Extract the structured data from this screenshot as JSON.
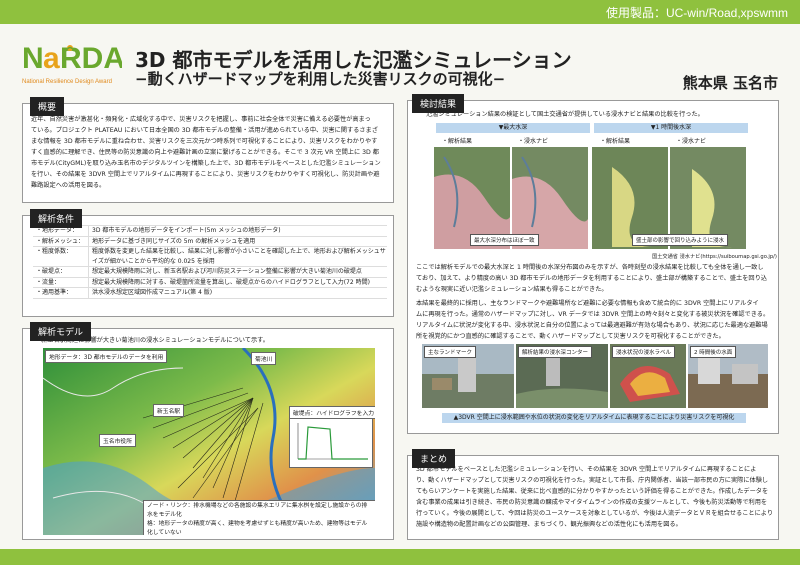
{
  "header": {
    "software": "使用製品：UC-win/Road,xpswmm",
    "logo_text": "NaRDA",
    "logo_sub": "National Resilience Design Award",
    "title": "3D 都市モデルを活用した氾濫シミュレーション",
    "subtitle": "−動くハザードマップを利用した災害リスクの可視化−",
    "city": "熊本県 玉名市"
  },
  "overview": {
    "heading": "概要",
    "lines": [
      "近年、自然災害が激甚化・頻発化・広域化する中で、災害リスクを把握し、事前に社会全体で災害に備える必要性が高まっ",
      "ている。プロジェクト PLATEAU において日本全国の 3D 都市モデルの整備・活用が進められている中、災害に関するさまざ",
      "まな情報を 3D 都市モデルに重ね合わせ、災害リスクを三次元かつ時系列で可視化することにより、災害リスクをわかりやす",
      "すく直感的に理解でき、住民等の防災意識の向上や避難計画の立案に繋げることができる。そこで 3 次元 VR 空間上に 3D 都",
      "市モデル(CityGML)を取り込み玉名市のデジタルツインを構築した上で、3D 都市モデルをベースとした氾濫シミュレーション",
      "を行い、その結果を 3DVR 空間上でリアルタイムに再現することにより、災害リスクをわかりやすく可視化し、防災計画や避",
      "難路設定への活用を図る。"
    ]
  },
  "conditions": {
    "heading": "解析条件",
    "rows": [
      {
        "k": "・地形データ：",
        "v": "3D 都市モデルの地形データをインポート(5m メッシュの地形データ)"
      },
      {
        "k": "・解析メッシュ：",
        "v": "地形データに基づき同じサイズの 5m の解析メッシュを適用"
      },
      {
        "k": "・粗度係数：",
        "v": "粗度係数を変更した結果を比較し、結果に対し影響が小さいことを確認した上で、地形および解析メッシュサイズが細かいことから平均的な 0.025 を採用"
      },
      {
        "k": "・破堤点：",
        "v": "想定最大規模降雨に対し、新玉名駅および河川防災ステーション整備に影響が大きい菊池川の破堤点"
      },
      {
        "k": "・流量：",
        "v": "想定最大規模降雨に対する、破堤箇所流量を算出し、破堤点からのハイドログラフとして入力(72 時間)"
      },
      {
        "k": "・適用基準：",
        "v": "洪水浸水想定区域図作成マニュアル(第 4 版)"
      }
    ]
  },
  "model": {
    "heading": "解析モデル",
    "intro": "新玉名駅周辺に影響が大きい菊池川の浸水シミュレーションモデルについて示す。",
    "label_terrain": "地形データ：3D 都市モデルのデータを利用",
    "label_river": "菊池川",
    "label_breach": "破堤点：ハイドログラフを入力",
    "label_station": "新玉名駅",
    "label_cityhall": "玉名市役所",
    "note1": "ノード・リンク：排水機場などの各施設の集水エリアに集水桝を設定し施設からの排水をモデル化",
    "note2": "格：地形データの精度が高く、建物を考慮せずとも精度が高いため、建物等はモデル化していない"
  },
  "results": {
    "heading": "検討結果",
    "intro": "氾濫シミュレーション結果の検証として国土交通省が提供している浸水ナビと結果の比較を行った。",
    "col1_title": "▼最大水深",
    "col2_title": "▼1 時間後水深",
    "label_analysis": "・解析結果",
    "label_navi": "・浸水ナビ",
    "caption_a": "最大水深分布はほぼ一致",
    "caption_b": "盛土部の影響で回り込みように浸水",
    "source": "国土交通省 浸水ナビ(https://suiboumap.gsi.go.jp/)",
    "para1": [
      "ここでは解析モデルでの最大水深と 1 時間後の水深分布図のみを示すが、各時刻型の浸水結果を比較しても全体を通し一致し",
      "ており、加えて、より精度の高い 3D 都市モデルの地形データを利用することにより、盛土部が構築することで、盛土を回り込",
      "むような現実に近い氾濫シミュレーション結果も得ることができた。"
    ],
    "para2": [
      "本結果を最終的に採用し、主なランドマークや避難場所など避難に必要な情報も含めて統合的に 3DVR 空間上にリアルタイ",
      "ムに再現を行った。通常のハザードマップに対し、VR データでは 3DVR 空間上の時々刻々と変化する被災状況を確認できる。",
      "リアルタイムに状況が変化する中、浸水状況と自分の位置によっては最適避難が有効な場合もあり、状況に応じた最適な避難場",
      "所を視覚的にかつ直感的に確認することで、動くハザードマップとして災害リスクを可視化することができた。"
    ],
    "img_label1": "主なランドマーク",
    "img_label2": "解析結果の浸水深コンター",
    "img_label3": "浸水状況の浸水ラベル",
    "img_label4": "2 時間後の水面",
    "bottom_caption": "▲3DVR 空間上に浸水範囲や水位の状況の変化をリアルタイムに表現することにより災害リスクを可視化"
  },
  "summary": {
    "heading": "まとめ",
    "lines": [
      "3D 都市モデルをベースとした氾濫シミュレーションを行い、その結果を 3DVR 空間上でリアルタイムに再現することによ",
      "り、動くハザードマップとして災害リスクの可視化を行った。実証として市長、庁内関係者、当該一部市民の方に実際に体験し",
      "てもらいアンケートを実施した結果、従来に比べ直感的に分かりやすかったという評価を得ることができた。作成したデータを",
      "含む事業の成果は引き続き、市民の防災意識の醸成やマイタイムラインの作成の支援ツールとして、今後も防災活動等で利用を",
      "行っていく。今後の展開として、今回は防災のユースケースを対象としているが、今後は人流データとＶＲを組合せることにより",
      "施設や構造物の配置計画などの公園管理、まちづくり、観光振興などの活性化にも活用を図る。"
    ]
  },
  "colors": {
    "accent_green": "#8fc13e",
    "heading_bg": "#222222"
  }
}
